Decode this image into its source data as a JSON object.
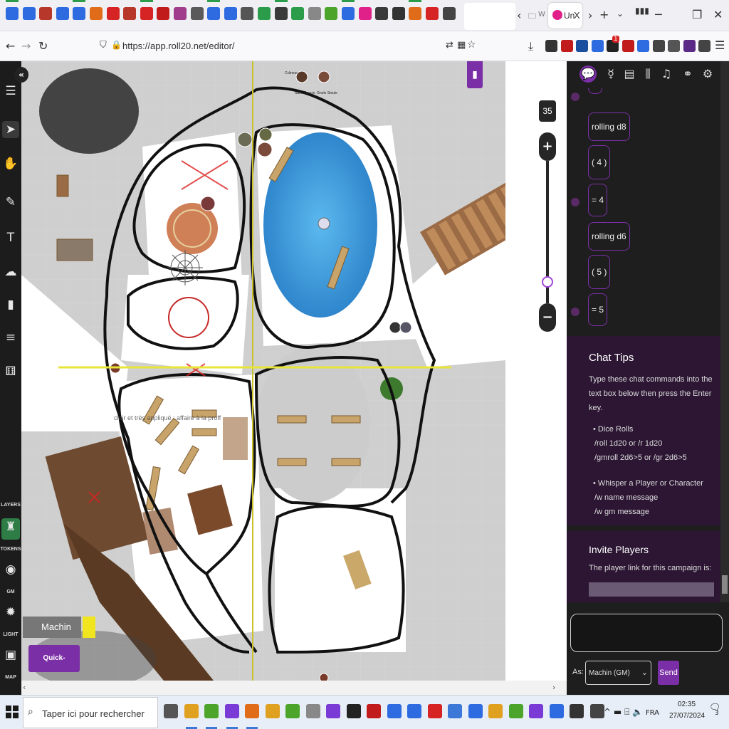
{
  "browser": {
    "active_tab": {
      "title": "Un",
      "close_label": "X"
    },
    "inactive_tab_title": "W",
    "pinned_favicon_colors": [
      "#2e6be0",
      "#2e6be0",
      "#b8372b",
      "#2e6be0",
      "#2e6be0",
      "#e06c1a",
      "#d62424",
      "#b8372b",
      "#d62424",
      "#c11b1b",
      "#a03c8b",
      "#5a5a5a",
      "#2e6be0",
      "#2e6be0",
      "#555555",
      "#2b9c4a",
      "#3a3a3a",
      "#2b9c4a",
      "#888888",
      "#4ca52a",
      "#2e6be0",
      "#e0218a",
      "#3a3a3a",
      "#333333",
      "#e06c1a",
      "#d62424",
      "#444444"
    ],
    "url": "https://app.roll20.net/editor/",
    "extension_badge": "1"
  },
  "roll20": {
    "zoom_value": "35",
    "zoom_level_fraction": 0.15,
    "left_tools": {
      "layers_label": "LAYERS",
      "tokens_label": "TOKENS",
      "gm_label": "GM",
      "light_label": "LIGHT",
      "map_label": "MAP"
    },
    "map_overlay_text": "clair et très appliqué : affaire à la proff",
    "token_labels": [
      "Crâneur",
      "Sans Gaucie",
      "Gnole Stoule"
    ],
    "player_name": "Machin",
    "player_color": "#f0e51f",
    "quick_reference_label": "Quick-Reference"
  },
  "chat": {
    "messages": [
      {
        "text": "rolling d8"
      },
      {
        "text": "( 4 )"
      },
      {
        "text": "= 4"
      },
      {
        "text": "rolling d6"
      },
      {
        "text": "( 5 )"
      },
      {
        "text": "= 5"
      }
    ],
    "tips": {
      "title": "Chat Tips",
      "intro": "Type these chat commands into the text box below then press the Enter key.",
      "dice_title": "Dice Rolls",
      "dice_cmd1": "/roll 1d20 or /r 1d20",
      "dice_cmd2": "/gmroll 2d6>5 or /gr 2d6>5",
      "whisper_title": "Whisper a Player or Character",
      "whisper_cmd1": "/w name message",
      "whisper_cmd2": "/w gm message"
    },
    "invite": {
      "title": "Invite Players",
      "text": "The player link for this campaign is:"
    },
    "as_label": "As:",
    "as_value": "Machin (GM)",
    "send_label": "Send"
  },
  "taskbar": {
    "search_placeholder": "Taper ici pour rechercher",
    "language": "FRA",
    "time": "02:35",
    "date": "27/07/2024",
    "notification_count": "3"
  },
  "colors": {
    "accent": "#7b2fa6",
    "sidebar_bg": "#1e1e1e",
    "tips_bg": "#2c1633",
    "water": "#3ea0e0"
  }
}
